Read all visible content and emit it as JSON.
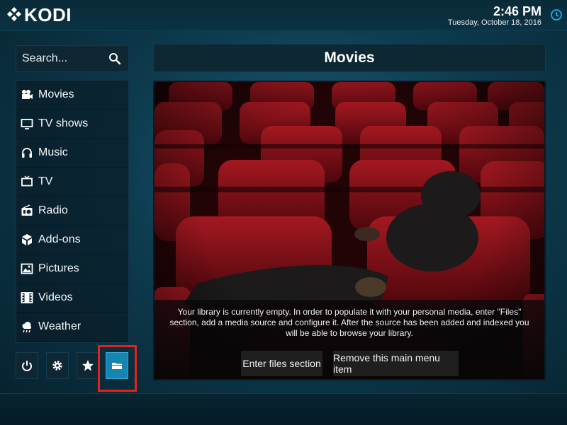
{
  "app": {
    "name": "KODI",
    "logo_icon": "kodi-logo-icon"
  },
  "clock": {
    "time": "2:46 PM",
    "date": "Tuesday, October 18, 2016",
    "icon": "clock-icon"
  },
  "search": {
    "label": "Search...",
    "icon": "search-icon"
  },
  "menu": {
    "items": [
      {
        "label": "Movies",
        "icon": "movies-icon"
      },
      {
        "label": "TV shows",
        "icon": "tv-shows-icon"
      },
      {
        "label": "Music",
        "icon": "headphones-icon"
      },
      {
        "label": "TV",
        "icon": "tv-icon"
      },
      {
        "label": "Radio",
        "icon": "radio-icon"
      },
      {
        "label": "Add-ons",
        "icon": "addons-icon"
      },
      {
        "label": "Pictures",
        "icon": "pictures-icon"
      },
      {
        "label": "Videos",
        "icon": "film-icon"
      },
      {
        "label": "Weather",
        "icon": "weather-icon"
      }
    ]
  },
  "bottom_buttons": [
    {
      "icon": "power-icon"
    },
    {
      "icon": "gear-icon"
    },
    {
      "icon": "star-icon"
    },
    {
      "icon": "folder-icon",
      "active": true
    }
  ],
  "main": {
    "title": "Movies",
    "message": "Your library is currently empty. In order to populate it with your personal media, enter \"Files\" section, add a media source and configure it. After the source has been added and indexed you will be able to browse your library.",
    "buttons": {
      "enter_files": "Enter files section",
      "remove_item": "Remove this main menu item"
    }
  },
  "colors": {
    "accent": "#1586b2",
    "highlight_box": "#e1231a",
    "background": "#0d3a4d"
  }
}
